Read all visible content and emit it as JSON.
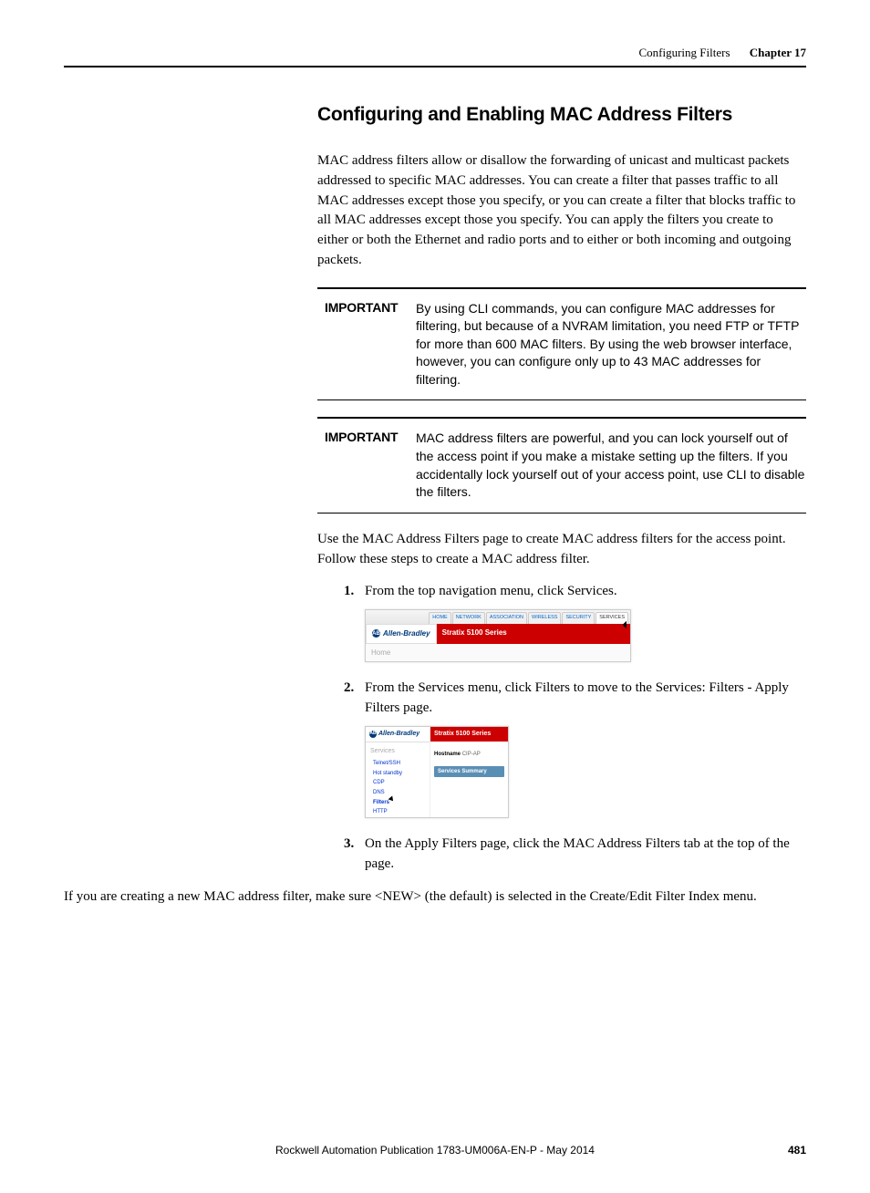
{
  "header": {
    "section": "Configuring Filters",
    "chapter": "Chapter 17"
  },
  "h2": "Configuring and Enabling MAC Address Filters",
  "intro": "MAC address filters allow or disallow the forwarding of unicast and multicast packets addressed to specific MAC addresses. You can create a filter that passes traffic to all MAC addresses except those you specify, or you can create a filter that blocks traffic to all MAC addresses except those you specify. You can apply the filters you create to either or both the Ethernet and radio ports and to either or both incoming and outgoing packets.",
  "important_label": "IMPORTANT",
  "important1": "By using CLI commands, you can configure MAC addresses for filtering, but because of a NVRAM limitation, you need FTP or TFTP for more than 600 MAC filters. By using the web browser interface, however, you can configure only up to 43 MAC addresses for filtering.",
  "important2": "MAC address filters are powerful, and you can lock yourself out of the access point if you make a mistake setting up the filters. If you accidentally lock yourself out of your access point, use CLI to disable the filters.",
  "para2": "Use the MAC Address Filters page to create MAC address filters for the access point. Follow these steps to create a MAC address filter.",
  "steps": {
    "s1": "From the top navigation menu, click Services.",
    "s2": "From the Services menu, click Filters to move to the Services: Filters - Apply Filters page.",
    "s3": "On the Apply Filters page, click the MAC Address Filters tab at the top of the page."
  },
  "closing": "If you are creating a new MAC address filter, make sure <NEW> (the default) is selected in the Create/Edit Filter Index menu.",
  "sc1": {
    "tabs": [
      "HOME",
      "NETWORK",
      "ASSOCIATION",
      "WIRELESS",
      "SECURITY",
      "SERVICES"
    ],
    "brand": "Allen-Bradley",
    "title": "Stratix 5100 Series",
    "home": "Home"
  },
  "sc2": {
    "brand": "Allen-Bradley",
    "title": "Stratix 5100 Series",
    "category": "Services",
    "links": [
      "Telnet/SSH",
      "Hot standby",
      "CDP",
      "DNS",
      "Filters",
      "HTTP"
    ],
    "hostname_label": "Hostname",
    "hostname_value": "CIP-AP",
    "summary": "Services Summary"
  },
  "footer": {
    "pub": "Rockwell Automation Publication 1783-UM006A-EN-P - May 2014",
    "page": "481"
  }
}
